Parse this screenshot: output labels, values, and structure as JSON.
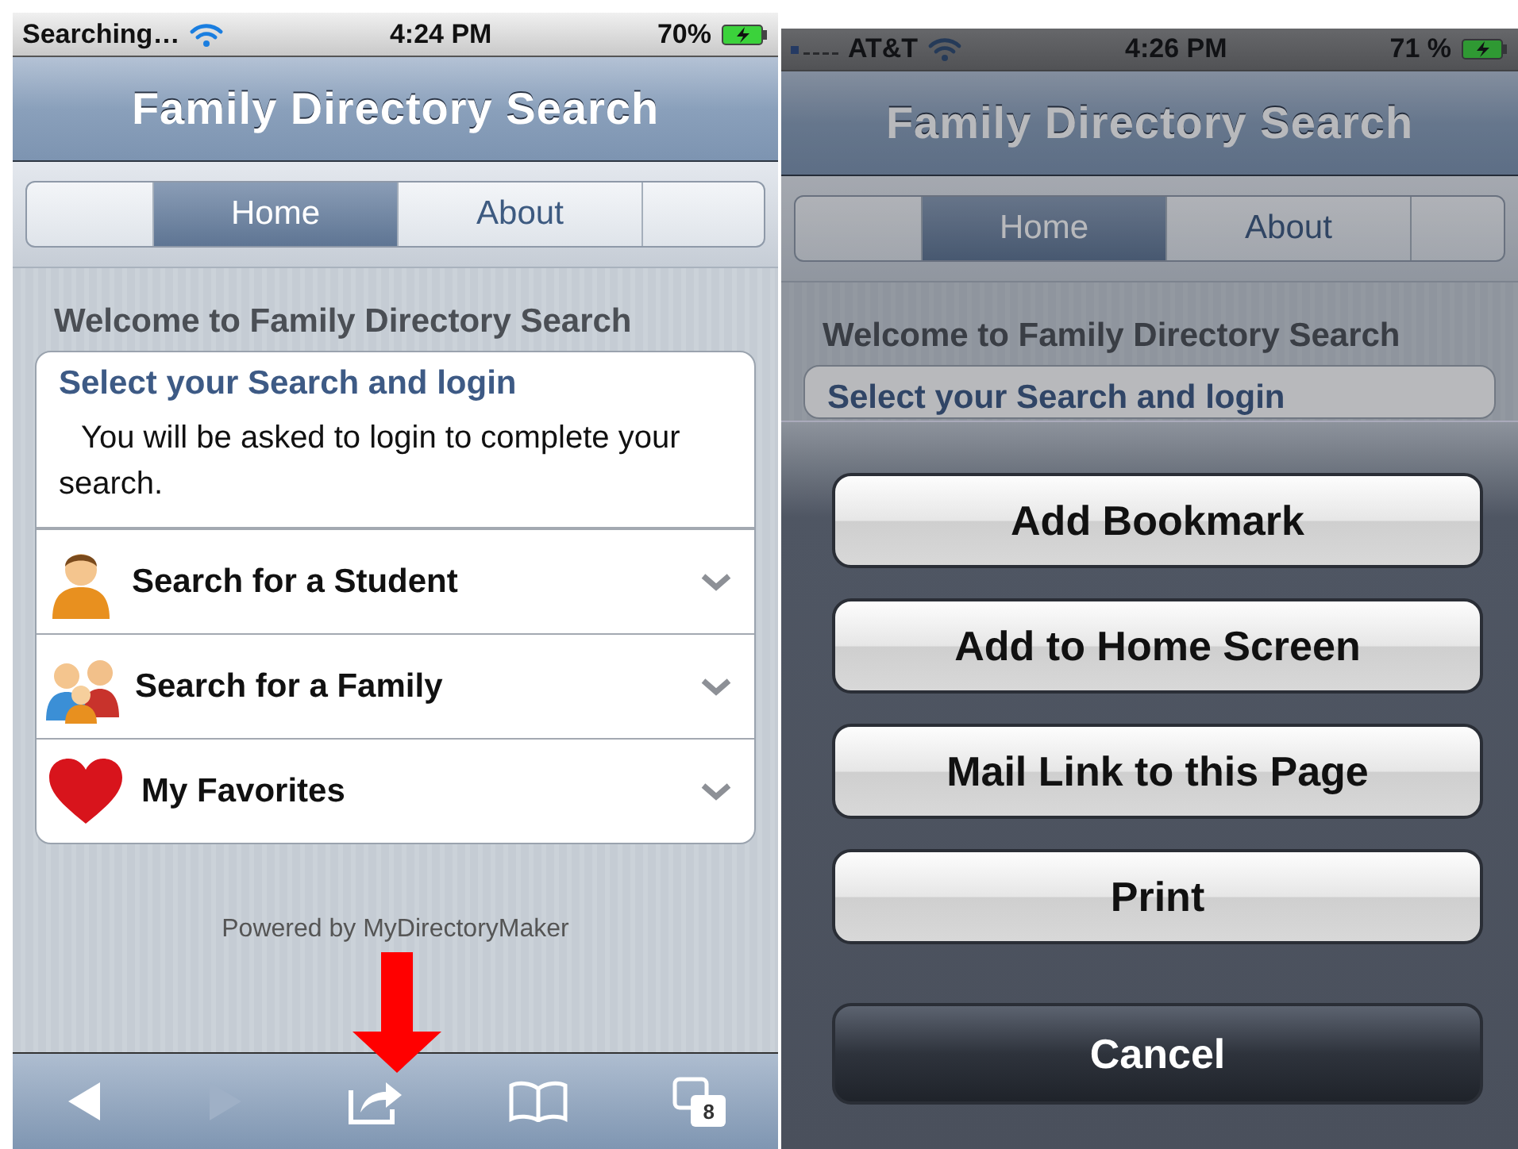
{
  "left_phone": {
    "status": {
      "carrier": "Searching…",
      "time": "4:24 PM",
      "battery": "70%"
    },
    "title": "Family Directory Search",
    "segments": [
      {
        "label": "Home",
        "selected": true
      },
      {
        "label": "About",
        "selected": false
      }
    ],
    "welcome": "Welcome to Family Directory Search",
    "card": {
      "heading": "Select your Search and login",
      "text": "You will be asked to login to complete your search."
    },
    "items": [
      {
        "kind": "student",
        "label": "Search for a Student"
      },
      {
        "kind": "family",
        "label": "Search for a Family"
      },
      {
        "kind": "favorites",
        "label": "My Favorites"
      }
    ],
    "footer": "Powered by MyDirectoryMaker",
    "toolbar": {
      "back_disabled": false,
      "forward_disabled": true,
      "pages_count": "8"
    }
  },
  "right_phone": {
    "status": {
      "signal_bars": true,
      "carrier": "AT&T",
      "time": "4:26 PM",
      "battery": "71 %"
    },
    "title": "Family Directory Search",
    "segments": [
      {
        "label": "Home",
        "selected": true
      },
      {
        "label": "About",
        "selected": false
      }
    ],
    "welcome": "Welcome to Family Directory Search",
    "card": {
      "heading": "Select your Search and login"
    },
    "sheet": {
      "buttons": [
        {
          "kind": "action",
          "label": "Add Bookmark"
        },
        {
          "kind": "action",
          "label": "Add to Home Screen"
        },
        {
          "kind": "action",
          "label": "Mail Link to this Page"
        },
        {
          "kind": "action",
          "label": "Print"
        },
        {
          "kind": "cancel",
          "label": "Cancel"
        }
      ]
    }
  }
}
